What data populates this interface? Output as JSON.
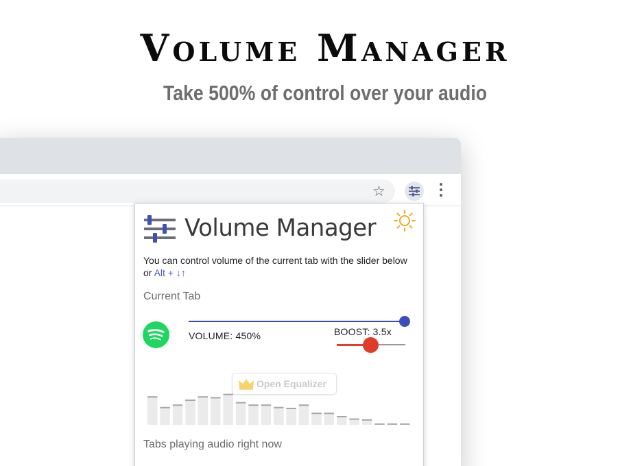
{
  "hero": {
    "title": "Volume Manager",
    "subtitle": "Take 500% of control over your audio"
  },
  "browser": {
    "toolbar_icons": [
      "star-icon",
      "extension-sliders-icon",
      "more-vert-icon"
    ]
  },
  "popup": {
    "title": "Volume Manager",
    "description": "You can control volume of the current tab with the slider below or ",
    "hotkey": "Alt + ↓↑",
    "current_tab_heading": "Current Tab",
    "volume_label": "VOLUME: 450%",
    "volume_level_percent": 450,
    "volume_max_percent": 500,
    "boost_label": "BOOST: 3.5x",
    "boost_level": 3.5,
    "equalizer_button": "Open Equalizer",
    "equalizer_levels": [
      0.68,
      0.42,
      0.48,
      0.6,
      0.68,
      0.66,
      0.74,
      0.54,
      0.48,
      0.48,
      0.42,
      0.4,
      0.48,
      0.28,
      0.28,
      0.2,
      0.14,
      0.12,
      0.02,
      0.02,
      0.02
    ],
    "tabs_heading": "Tabs playing audio right now"
  },
  "colors": {
    "volume_accent": "#3d4fb7",
    "boost_accent": "#e03c2a",
    "spotify_green": "#1ed760",
    "sun_orange": "#f5a623",
    "hotkey_blue": "#4b5bdc"
  }
}
